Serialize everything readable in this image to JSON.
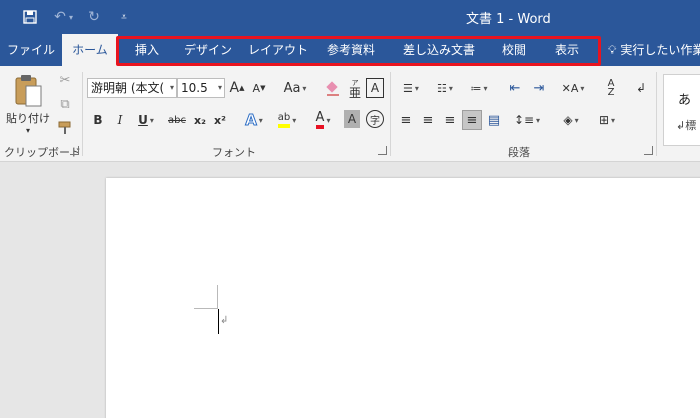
{
  "titlebar": {
    "title": "文書 1  -  Word",
    "qat": {
      "save_icon": "save-icon",
      "undo_icon": "undo-icon",
      "redo_icon": "redo-icon",
      "customize_icon": "customize-qat-icon"
    }
  },
  "tabs": [
    {
      "label": "ファイル",
      "active": false
    },
    {
      "label": "ホーム",
      "active": true
    },
    {
      "label": "挿入",
      "active": false
    },
    {
      "label": "デザイン",
      "active": false
    },
    {
      "label": "レイアウト",
      "active": false
    },
    {
      "label": "参考資料",
      "active": false
    },
    {
      "label": "差し込み文書",
      "active": false
    },
    {
      "label": "校閲",
      "active": false
    },
    {
      "label": "表示",
      "active": false
    }
  ],
  "tell_me": {
    "text": "実行したい作業"
  },
  "highlight_color": "#e8141f",
  "ribbon": {
    "clipboard": {
      "label": "クリップボード",
      "paste_label": "貼り付け"
    },
    "font": {
      "label": "フォント",
      "font_name": "游明朝 (本文(",
      "font_size": "10.5",
      "change_case": "Aa",
      "bold": "B",
      "italic": "I",
      "underline": "U",
      "strike": "abc",
      "subscript": "x₂",
      "superscript": "x²",
      "font_color_letter": "A",
      "shade_letter": "A",
      "border_letter": "A",
      "ruby": "亜",
      "enclose": "字",
      "grow": "A",
      "shrink": "A"
    },
    "paragraph": {
      "label": "段落"
    },
    "styles": {
      "preview_1": "あ",
      "preview_2": "標"
    }
  },
  "colors": {
    "brand": "#2b579a",
    "font_color": "#e81123",
    "highlight": "#ffff00"
  }
}
